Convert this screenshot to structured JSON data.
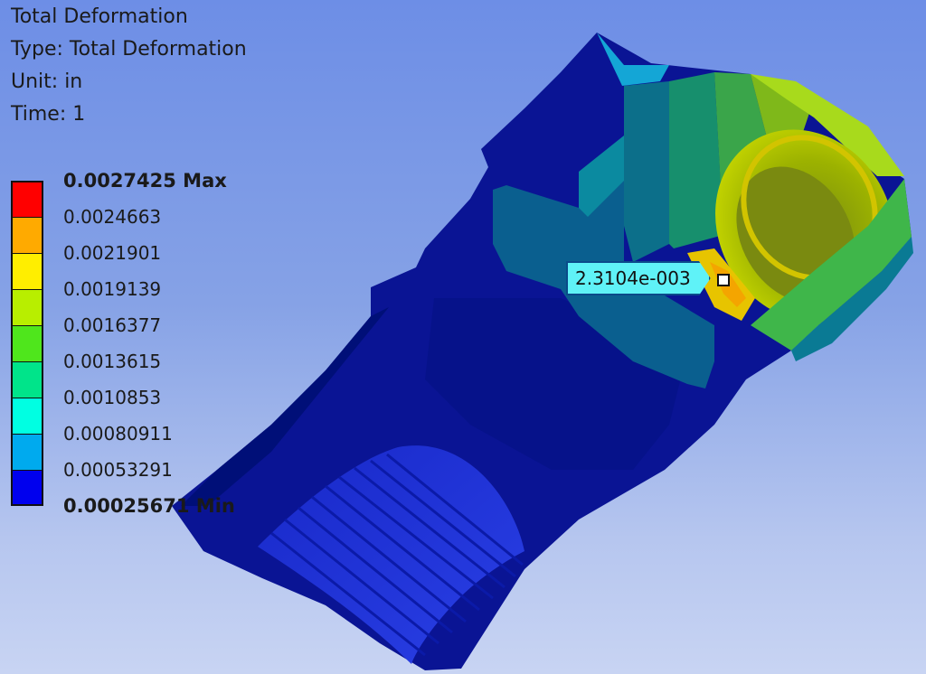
{
  "result_info": {
    "title": "Total Deformation",
    "type": "Type: Total Deformation",
    "unit": "Unit: in",
    "time": "Time: 1"
  },
  "legend": {
    "entries": [
      {
        "label": "0.0027425 Max",
        "color": "#ff0000"
      },
      {
        "label": "0.0024663",
        "color": "#ffaa00"
      },
      {
        "label": "0.0021901",
        "color": "#ffee00"
      },
      {
        "label": "0.0019139",
        "color": "#b8ee00"
      },
      {
        "label": "0.0016377",
        "color": "#4fe61c"
      },
      {
        "label": "0.0013615",
        "color": "#00e48a"
      },
      {
        "label": "0.0010853",
        "color": "#00ffe2"
      },
      {
        "label": "0.00080911",
        "color": "#00aaee"
      },
      {
        "label": "0.00053291",
        "color": "#0000ee"
      },
      {
        "label": "0.00025671 Min",
        "color": ""
      }
    ]
  },
  "probe": {
    "value": "2.3104e-003"
  }
}
